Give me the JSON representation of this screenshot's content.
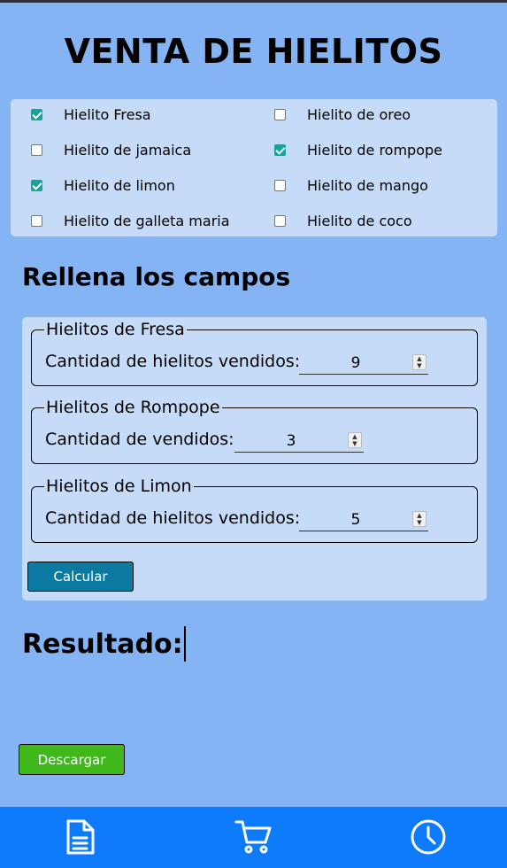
{
  "header": {
    "title": "VENTA DE HIELITOS"
  },
  "flavors": [
    {
      "label": "Hielito Fresa",
      "checked": true
    },
    {
      "label": "Hielito de oreo",
      "checked": false
    },
    {
      "label": "Hielito de jamaica",
      "checked": false
    },
    {
      "label": "Hielito de rompope",
      "checked": true
    },
    {
      "label": "Hielito de limon",
      "checked": true
    },
    {
      "label": "Hielito de mango",
      "checked": false
    },
    {
      "label": "Hielito de galleta maria",
      "checked": false
    },
    {
      "label": "Hielito de coco",
      "checked": false
    }
  ],
  "form": {
    "title": "Rellena los campos",
    "groups": [
      {
        "legend": "Hielitos de Fresa",
        "label": "Cantidad de hielitos vendidos:",
        "value": "9"
      },
      {
        "legend": "Hielitos de Rompope",
        "label": "Cantidad de vendidos:",
        "value": "3"
      },
      {
        "legend": "Hielitos de Limon",
        "label": "Cantidad de hielitos vendidos:",
        "value": "5"
      }
    ],
    "calc_label": "Calcular"
  },
  "result": {
    "label": "Resultado:"
  },
  "download_label": "Descargar",
  "nav": {
    "icons": [
      "document-icon",
      "cart-icon",
      "clock-icon"
    ]
  },
  "colors": {
    "background": "#84b4f4",
    "panel": "#c6dbf7",
    "nav": "#0d7bfc",
    "calc_button": "#0a7aa3",
    "download_button": "#3fb81c",
    "checkbox_checked": "#14a59a"
  }
}
